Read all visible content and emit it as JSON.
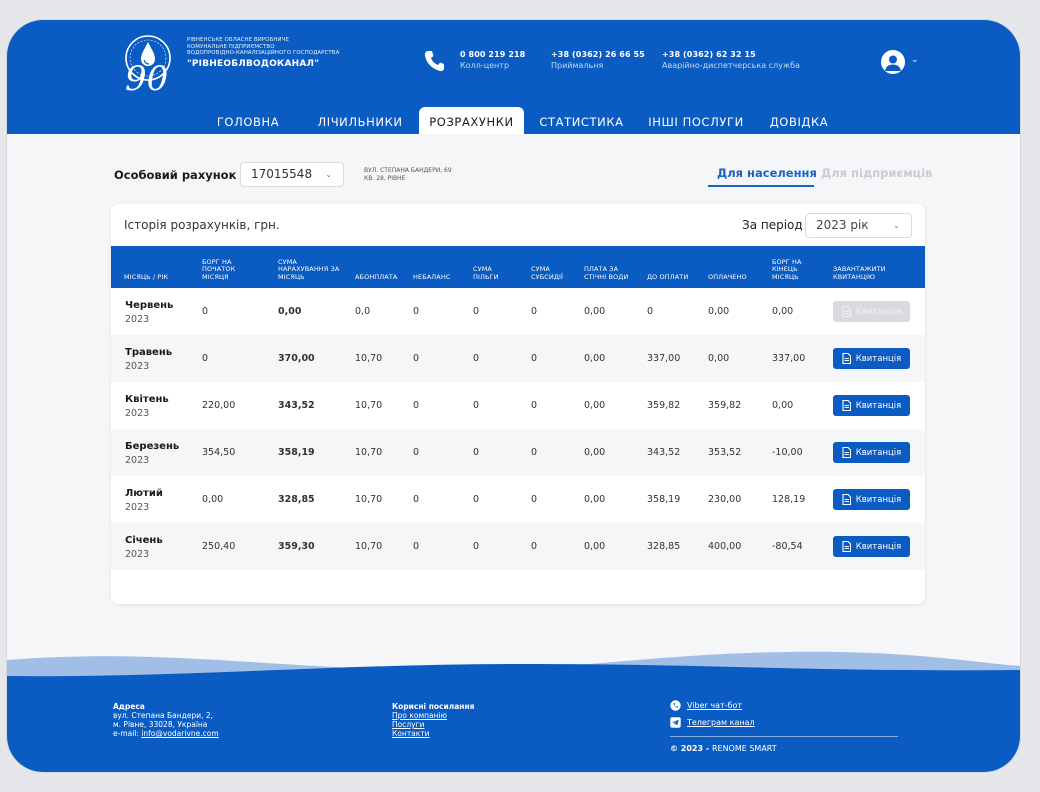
{
  "header": {
    "org_line1": "Рівненське обласне виробниче",
    "org_line2": "комунальне підприємство",
    "org_line3": "водопровідно-каналізаційного господарства",
    "brand": "\"РІВНЕОБЛВОДОКАНАЛ\"",
    "logo_number": "90",
    "contacts": [
      {
        "number": "0 800 219 218",
        "label": "Колл-центр"
      },
      {
        "number": "+38 (0362) 26 66 55",
        "label": "Приймальня"
      },
      {
        "number": "+38 (0362) 62 32 15",
        "label": "Аварійно-диспетчерська служба"
      }
    ]
  },
  "nav": [
    {
      "label": "ГОЛОВНА"
    },
    {
      "label": "ЛІЧИЛЬНИКИ"
    },
    {
      "label": "РОЗРАХУНКИ"
    },
    {
      "label": "СТАТИСТИКА"
    },
    {
      "label": "ІНШІ ПОСЛУГИ"
    },
    {
      "label": "ДОВІДКА"
    }
  ],
  "account": {
    "label": "Особовий рахунок",
    "value": "17015548",
    "address_line1": "ВУЛ. СТЕПАНА БАНДЕРИ, 69",
    "address_line2": "КВ. 28, РІВНЕ"
  },
  "segment": {
    "population": "Для населення",
    "business": "Для підприємців"
  },
  "history": {
    "title": "Історія розрахунків, грн.",
    "period_label": "За період",
    "period_value": "2023 рік",
    "columns": [
      "Місяць / рік",
      "Борг на початок місяця",
      "Сума нарахування за місяць",
      "Абонплата",
      "Небаланс",
      "Сума пільги",
      "Сума субсидії",
      "Плата за стічні води",
      "До оплати",
      "Оплачено",
      "Борг на кінець місяць",
      "Завантажити квитанцію"
    ],
    "rows": [
      {
        "month": "Червень",
        "year": "2023",
        "debt_start": "0",
        "charge": "0,00",
        "fee": "0,0",
        "imbalance": "0",
        "benefit": "0",
        "subsidy": "0",
        "sewage": "0,00",
        "to_pay": "0",
        "paid": "0,00",
        "debt_end": "0,00",
        "button": "Квитанція",
        "disabled": true
      },
      {
        "month": "Травень",
        "year": "2023",
        "debt_start": "0",
        "charge": "370,00",
        "fee": "10,70",
        "imbalance": "0",
        "benefit": "0",
        "subsidy": "0",
        "sewage": "0,00",
        "to_pay": "337,00",
        "paid": "0,00",
        "debt_end": "337,00",
        "button": "Квитанція",
        "disabled": false
      },
      {
        "month": "Квітень",
        "year": "2023",
        "debt_start": "220,00",
        "charge": "343,52",
        "fee": "10,70",
        "imbalance": "0",
        "benefit": "0",
        "subsidy": "0",
        "sewage": "0,00",
        "to_pay": "359,82",
        "paid": "359,82",
        "debt_end": "0,00",
        "button": "Квитанція",
        "disabled": false
      },
      {
        "month": "Березень",
        "year": "2023",
        "debt_start": "354,50",
        "charge": "358,19",
        "fee": "10,70",
        "imbalance": "0",
        "benefit": "0",
        "subsidy": "0",
        "sewage": "0,00",
        "to_pay": "343,52",
        "paid": "353,52",
        "debt_end": "-10,00",
        "button": "Квитанція",
        "disabled": false
      },
      {
        "month": "Лютий",
        "year": "2023",
        "debt_start": "0,00",
        "charge": "328,85",
        "fee": "10,70",
        "imbalance": "0",
        "benefit": "0",
        "subsidy": "0",
        "sewage": "0,00",
        "to_pay": "358,19",
        "paid": "230,00",
        "debt_end": "128,19",
        "button": "Квитанція",
        "disabled": false
      },
      {
        "month": "Січень",
        "year": "2023",
        "debt_start": "250,40",
        "charge": "359,30",
        "fee": "10,70",
        "imbalance": "0",
        "benefit": "0",
        "subsidy": "0",
        "sewage": "0,00",
        "to_pay": "328,85",
        "paid": "400,00",
        "debt_end": "-80,54",
        "button": "Квитанція",
        "disabled": false
      }
    ]
  },
  "footer": {
    "address_title": "Адреса",
    "address_line1": "вул. Степана Бандери, 2,",
    "address_line2": "м. Рівне, 33028, Україна",
    "email_label": "e-mail: ",
    "email": "info@vodarivne.com",
    "links_title": "Корисні посилання",
    "links": [
      "Про компанію",
      "Послуги",
      "Контакти"
    ],
    "viber": "Viber чат-бот",
    "telegram": "Телеграм канал",
    "copyright": "© 2023 - ",
    "copyright_brand": "RENOME SMART"
  },
  "colors": {
    "primary": "#0a5cc2",
    "page_bg": "#f5f6f8",
    "disabled": "#d8dadd",
    "segment_active": "#1a63c4"
  }
}
